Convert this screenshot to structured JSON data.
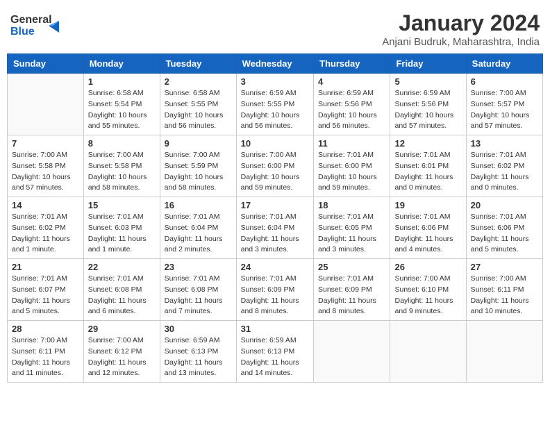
{
  "header": {
    "logo_line1": "General",
    "logo_line2": "Blue",
    "month_title": "January 2024",
    "location": "Anjani Budruk, Maharashtra, India"
  },
  "weekdays": [
    "Sunday",
    "Monday",
    "Tuesday",
    "Wednesday",
    "Thursday",
    "Friday",
    "Saturday"
  ],
  "weeks": [
    [
      {
        "day": "",
        "sunrise": "",
        "sunset": "",
        "daylight": ""
      },
      {
        "day": "1",
        "sunrise": "Sunrise: 6:58 AM",
        "sunset": "Sunset: 5:54 PM",
        "daylight": "Daylight: 10 hours and 55 minutes."
      },
      {
        "day": "2",
        "sunrise": "Sunrise: 6:58 AM",
        "sunset": "Sunset: 5:55 PM",
        "daylight": "Daylight: 10 hours and 56 minutes."
      },
      {
        "day": "3",
        "sunrise": "Sunrise: 6:59 AM",
        "sunset": "Sunset: 5:55 PM",
        "daylight": "Daylight: 10 hours and 56 minutes."
      },
      {
        "day": "4",
        "sunrise": "Sunrise: 6:59 AM",
        "sunset": "Sunset: 5:56 PM",
        "daylight": "Daylight: 10 hours and 56 minutes."
      },
      {
        "day": "5",
        "sunrise": "Sunrise: 6:59 AM",
        "sunset": "Sunset: 5:56 PM",
        "daylight": "Daylight: 10 hours and 57 minutes."
      },
      {
        "day": "6",
        "sunrise": "Sunrise: 7:00 AM",
        "sunset": "Sunset: 5:57 PM",
        "daylight": "Daylight: 10 hours and 57 minutes."
      }
    ],
    [
      {
        "day": "7",
        "sunrise": "Sunrise: 7:00 AM",
        "sunset": "Sunset: 5:58 PM",
        "daylight": "Daylight: 10 hours and 57 minutes."
      },
      {
        "day": "8",
        "sunrise": "Sunrise: 7:00 AM",
        "sunset": "Sunset: 5:58 PM",
        "daylight": "Daylight: 10 hours and 58 minutes."
      },
      {
        "day": "9",
        "sunrise": "Sunrise: 7:00 AM",
        "sunset": "Sunset: 5:59 PM",
        "daylight": "Daylight: 10 hours and 58 minutes."
      },
      {
        "day": "10",
        "sunrise": "Sunrise: 7:00 AM",
        "sunset": "Sunset: 6:00 PM",
        "daylight": "Daylight: 10 hours and 59 minutes."
      },
      {
        "day": "11",
        "sunrise": "Sunrise: 7:01 AM",
        "sunset": "Sunset: 6:00 PM",
        "daylight": "Daylight: 10 hours and 59 minutes."
      },
      {
        "day": "12",
        "sunrise": "Sunrise: 7:01 AM",
        "sunset": "Sunset: 6:01 PM",
        "daylight": "Daylight: 11 hours and 0 minutes."
      },
      {
        "day": "13",
        "sunrise": "Sunrise: 7:01 AM",
        "sunset": "Sunset: 6:02 PM",
        "daylight": "Daylight: 11 hours and 0 minutes."
      }
    ],
    [
      {
        "day": "14",
        "sunrise": "Sunrise: 7:01 AM",
        "sunset": "Sunset: 6:02 PM",
        "daylight": "Daylight: 11 hours and 1 minute."
      },
      {
        "day": "15",
        "sunrise": "Sunrise: 7:01 AM",
        "sunset": "Sunset: 6:03 PM",
        "daylight": "Daylight: 11 hours and 1 minute."
      },
      {
        "day": "16",
        "sunrise": "Sunrise: 7:01 AM",
        "sunset": "Sunset: 6:04 PM",
        "daylight": "Daylight: 11 hours and 2 minutes."
      },
      {
        "day": "17",
        "sunrise": "Sunrise: 7:01 AM",
        "sunset": "Sunset: 6:04 PM",
        "daylight": "Daylight: 11 hours and 3 minutes."
      },
      {
        "day": "18",
        "sunrise": "Sunrise: 7:01 AM",
        "sunset": "Sunset: 6:05 PM",
        "daylight": "Daylight: 11 hours and 3 minutes."
      },
      {
        "day": "19",
        "sunrise": "Sunrise: 7:01 AM",
        "sunset": "Sunset: 6:06 PM",
        "daylight": "Daylight: 11 hours and 4 minutes."
      },
      {
        "day": "20",
        "sunrise": "Sunrise: 7:01 AM",
        "sunset": "Sunset: 6:06 PM",
        "daylight": "Daylight: 11 hours and 5 minutes."
      }
    ],
    [
      {
        "day": "21",
        "sunrise": "Sunrise: 7:01 AM",
        "sunset": "Sunset: 6:07 PM",
        "daylight": "Daylight: 11 hours and 5 minutes."
      },
      {
        "day": "22",
        "sunrise": "Sunrise: 7:01 AM",
        "sunset": "Sunset: 6:08 PM",
        "daylight": "Daylight: 11 hours and 6 minutes."
      },
      {
        "day": "23",
        "sunrise": "Sunrise: 7:01 AM",
        "sunset": "Sunset: 6:08 PM",
        "daylight": "Daylight: 11 hours and 7 minutes."
      },
      {
        "day": "24",
        "sunrise": "Sunrise: 7:01 AM",
        "sunset": "Sunset: 6:09 PM",
        "daylight": "Daylight: 11 hours and 8 minutes."
      },
      {
        "day": "25",
        "sunrise": "Sunrise: 7:01 AM",
        "sunset": "Sunset: 6:09 PM",
        "daylight": "Daylight: 11 hours and 8 minutes."
      },
      {
        "day": "26",
        "sunrise": "Sunrise: 7:00 AM",
        "sunset": "Sunset: 6:10 PM",
        "daylight": "Daylight: 11 hours and 9 minutes."
      },
      {
        "day": "27",
        "sunrise": "Sunrise: 7:00 AM",
        "sunset": "Sunset: 6:11 PM",
        "daylight": "Daylight: 11 hours and 10 minutes."
      }
    ],
    [
      {
        "day": "28",
        "sunrise": "Sunrise: 7:00 AM",
        "sunset": "Sunset: 6:11 PM",
        "daylight": "Daylight: 11 hours and 11 minutes."
      },
      {
        "day": "29",
        "sunrise": "Sunrise: 7:00 AM",
        "sunset": "Sunset: 6:12 PM",
        "daylight": "Daylight: 11 hours and 12 minutes."
      },
      {
        "day": "30",
        "sunrise": "Sunrise: 6:59 AM",
        "sunset": "Sunset: 6:13 PM",
        "daylight": "Daylight: 11 hours and 13 minutes."
      },
      {
        "day": "31",
        "sunrise": "Sunrise: 6:59 AM",
        "sunset": "Sunset: 6:13 PM",
        "daylight": "Daylight: 11 hours and 14 minutes."
      },
      {
        "day": "",
        "sunrise": "",
        "sunset": "",
        "daylight": ""
      },
      {
        "day": "",
        "sunrise": "",
        "sunset": "",
        "daylight": ""
      },
      {
        "day": "",
        "sunrise": "",
        "sunset": "",
        "daylight": ""
      }
    ]
  ]
}
